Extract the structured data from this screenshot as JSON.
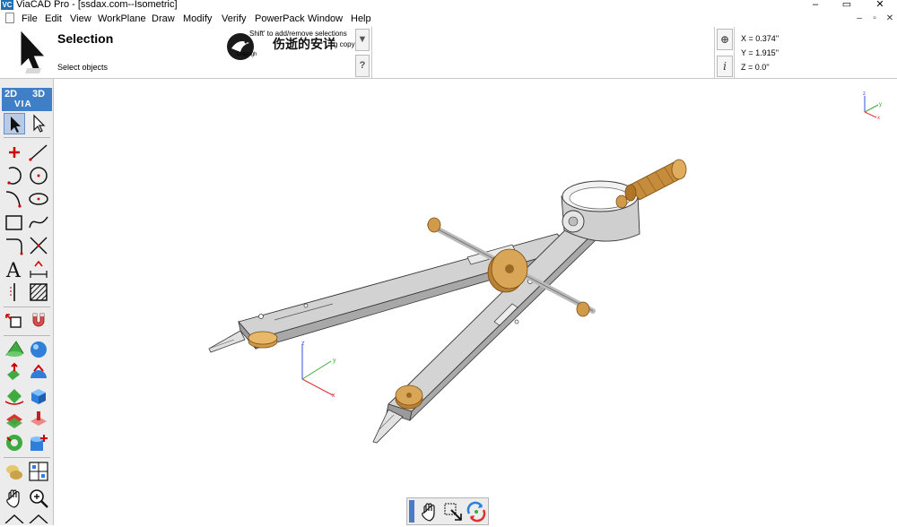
{
  "window": {
    "app_icon_label": "VC",
    "title": "ViaCAD Pro - [ssdax.com--Isometric]",
    "controls": [
      "–",
      "▭",
      "✕"
    ]
  },
  "menu": {
    "items": [
      "File",
      "Edit",
      "View",
      "WorkPlane",
      "Draw",
      "Modify",
      "Verify",
      "PowerPack",
      "Window",
      "Help"
    ],
    "mdi_controls": [
      "–",
      "▫",
      "✕"
    ]
  },
  "ribbon": {
    "title": "Selection",
    "subtitle": "Select objects",
    "hint_shift": "Shift' to add/remove selections",
    "hint_copy": "g copy",
    "hint_drag": "Drag righ                                              ",
    "watermark_name": "伤逝的安详",
    "side_buttons": [
      "▼",
      "?"
    ],
    "coord_buttons": [
      "⊕",
      "i"
    ],
    "coords": {
      "x": "X = 0.374''",
      "y": "Y = 1.915''",
      "z": "Z = 0.0''"
    }
  },
  "toolbar": {
    "mode_2d": "2D",
    "mode_3d": "3D",
    "mode_via": "VIA",
    "tools": [
      "select-arrow-icon",
      "select-hollow-arrow-icon",
      "point-icon",
      "line-icon",
      "arc-icon",
      "circle-icon",
      "fillet-curve-icon",
      "ellipse-icon",
      "rectangle-icon",
      "spline-icon",
      "corner-icon",
      "trim-icon",
      "text-icon",
      "dimension-icon",
      "construction-line-icon",
      "hatch-icon",
      "transform-icon",
      "magnet-icon",
      "cone-icon",
      "sphere-icon",
      "extrude-icon",
      "dome-icon",
      "revolve-icon",
      "box-icon",
      "boolean-icon",
      "shell-icon",
      "torus-icon",
      "solid-edit-icon",
      "material-icon",
      "view-layout-icon",
      "pan-hand-icon",
      "zoom-icon"
    ]
  },
  "viewport": {
    "triad_labels": {
      "x": "x",
      "y": "y",
      "z": "z"
    },
    "colors": {
      "steel": "#c6c6c6",
      "steel_dark": "#8a8a8a",
      "brass": "#d19a4a",
      "brass_dark": "#9a6a22",
      "axis_x": "#e03030",
      "axis_y": "#3aaa3a",
      "axis_z": "#3050d0"
    }
  },
  "bottom_tools": [
    "pan-hand-icon",
    "zoom-window-icon",
    "rotate-view-icon"
  ]
}
